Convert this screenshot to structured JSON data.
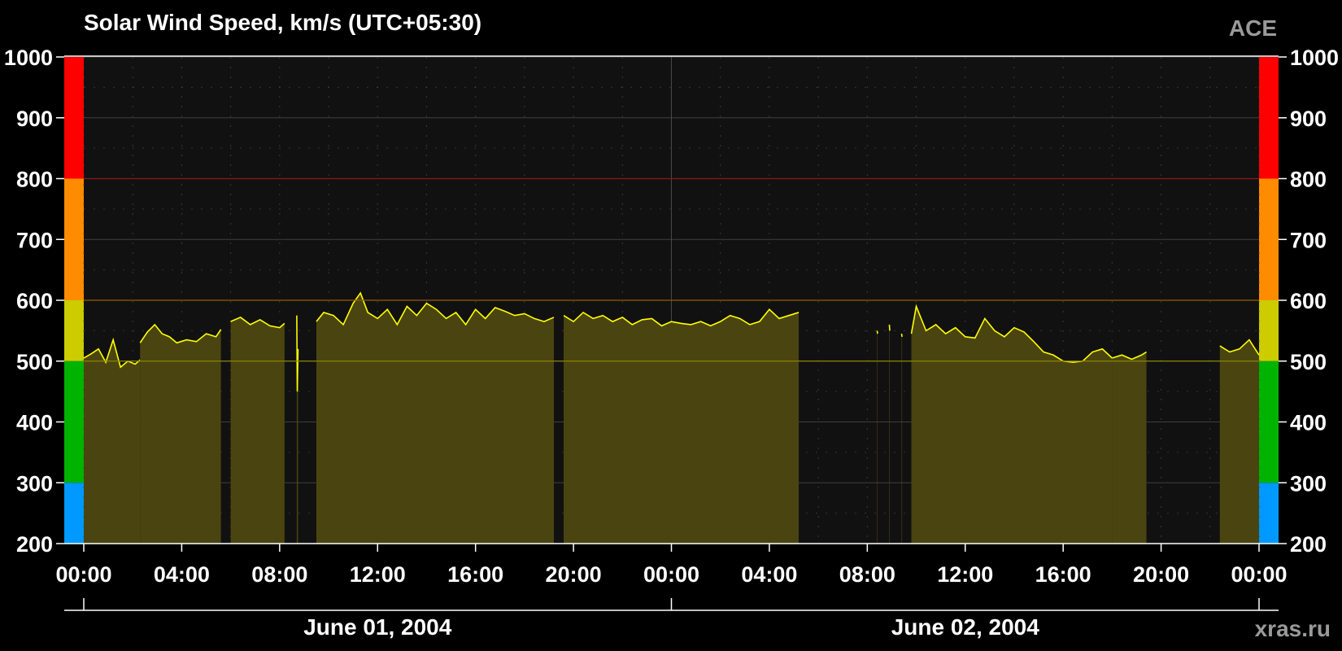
{
  "header": {
    "title": "Solar Wind Speed, km/s (UTC+05:30)",
    "source": "ACE"
  },
  "footer": {
    "credit": "xras.ru"
  },
  "colors": {
    "background": "#000000",
    "plot_bg": "#111111",
    "line": "#ffff00",
    "fill": "#4a4510",
    "grid": "#444444",
    "threshold_800": "#8b1a1a",
    "threshold_600": "#9a5a00",
    "threshold_500": "#8a8500"
  },
  "chart_data": {
    "type": "area",
    "title": "Solar Wind Speed, km/s (UTC+05:30)",
    "ylim": [
      200,
      1000
    ],
    "xlim_hours": [
      0,
      48
    ],
    "y_ticks": [
      "200",
      "300",
      "400",
      "500",
      "600",
      "700",
      "800",
      "900",
      "1000"
    ],
    "x_ticks": [
      "00:00",
      "04:00",
      "08:00",
      "12:00",
      "16:00",
      "20:00",
      "00:00",
      "04:00",
      "08:00",
      "12:00",
      "16:00",
      "20:00",
      "00:00"
    ],
    "date_labels": [
      "June 01, 2004",
      "June 02, 2004"
    ],
    "thresholds": [
      500,
      600,
      800
    ],
    "color_scale": [
      {
        "from": 200,
        "to": 300,
        "color": "#0099ff"
      },
      {
        "from": 300,
        "to": 500,
        "color": "#00b300"
      },
      {
        "from": 500,
        "to": 600,
        "color": "#cccc00"
      },
      {
        "from": 600,
        "to": 800,
        "color": "#ff8c00"
      },
      {
        "from": 800,
        "to": 1000,
        "color": "#ff0000"
      }
    ],
    "segments": [
      {
        "x": [
          0.0,
          0.3,
          0.6,
          0.9,
          1.2,
          1.5,
          1.8,
          2.1,
          2.3
        ],
        "y": [
          505,
          512,
          520,
          498,
          535,
          490,
          500,
          495,
          502
        ]
      },
      {
        "x": [
          2.3,
          2.6,
          2.9,
          3.2,
          3.5,
          3.8,
          4.2,
          4.6,
          5.0,
          5.4,
          5.6
        ],
        "y": [
          530,
          548,
          560,
          545,
          540,
          530,
          535,
          532,
          545,
          540,
          552
        ]
      },
      {
        "x": [
          6.0,
          6.4,
          6.8,
          7.2,
          7.6,
          8.0,
          8.2
        ],
        "y": [
          565,
          572,
          560,
          568,
          558,
          555,
          562
        ]
      },
      {
        "x": [
          8.7,
          8.72,
          8.75
        ],
        "y": [
          575,
          450,
          520
        ]
      },
      {
        "x": [
          9.5,
          9.8,
          10.2,
          10.6,
          11.0,
          11.3,
          11.6,
          12.0,
          12.4,
          12.8,
          13.2,
          13.6,
          14.0,
          14.4,
          14.8,
          15.2,
          15.6,
          16.0,
          16.4,
          16.8,
          17.2,
          17.6,
          18.0,
          18.4,
          18.8,
          19.2
        ],
        "y": [
          565,
          580,
          575,
          560,
          595,
          612,
          580,
          570,
          585,
          560,
          590,
          575,
          595,
          585,
          570,
          580,
          560,
          585,
          570,
          588,
          582,
          575,
          578,
          570,
          565,
          572
        ]
      },
      {
        "x": [
          19.6,
          20.0,
          20.4,
          20.8,
          21.2,
          21.6,
          22.0,
          22.4,
          22.8,
          23.2,
          23.6,
          24.0,
          24.4,
          24.8,
          25.2,
          25.6,
          26.0,
          26.4,
          26.8,
          27.2,
          27.6,
          28.0,
          28.4,
          28.8,
          29.2
        ],
        "y": [
          575,
          565,
          580,
          570,
          575,
          565,
          572,
          560,
          568,
          570,
          558,
          565,
          562,
          560,
          565,
          558,
          565,
          575,
          570,
          560,
          565,
          585,
          570,
          575,
          580
        ]
      },
      {
        "x": [
          32.4,
          32.42
        ],
        "y": [
          550,
          545
        ]
      },
      {
        "x": [
          32.9,
          32.92
        ],
        "y": [
          560,
          550
        ]
      },
      {
        "x": [
          33.4,
          33.42
        ],
        "y": [
          545,
          540
        ]
      },
      {
        "x": [
          33.8,
          34.0,
          34.4,
          34.8,
          35.2,
          35.6,
          36.0,
          36.4,
          36.8,
          37.2,
          37.6,
          38.0,
          38.4,
          38.8,
          39.2,
          39.6,
          40.0,
          40.4,
          40.8,
          41.2,
          41.6,
          42.0
        ],
        "y": [
          545,
          590,
          550,
          560,
          545,
          555,
          540,
          538,
          570,
          550,
          540,
          555,
          548,
          532,
          515,
          510,
          500,
          498,
          500,
          515,
          520,
          505
        ]
      },
      {
        "x": [
          42.0,
          42.4,
          42.8,
          43.2,
          43.4
        ],
        "y": [
          505,
          510,
          503,
          510,
          515
        ]
      },
      {
        "x": [
          46.4,
          46.8,
          47.2,
          47.6,
          48.0
        ],
        "y": [
          525,
          515,
          520,
          535,
          510
        ]
      }
    ]
  }
}
